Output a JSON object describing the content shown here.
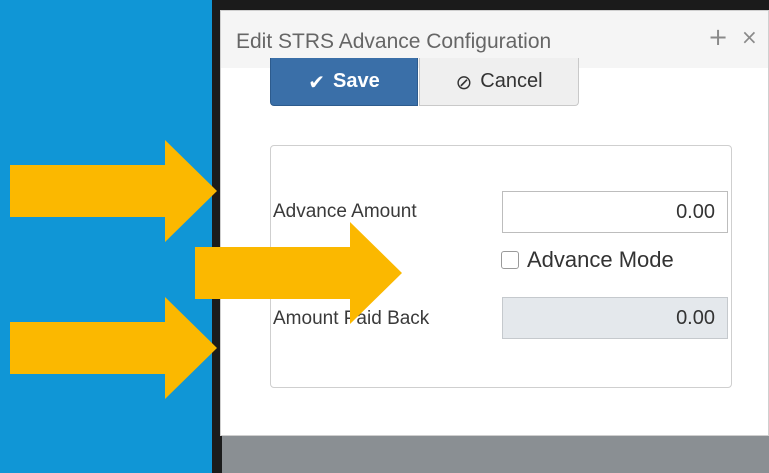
{
  "dialog": {
    "title": "Edit STRS Advance Configuration",
    "pin_glyph": "+",
    "close_glyph": "×"
  },
  "toolbar": {
    "save_label": "Save",
    "save_icon": "✔",
    "cancel_label": "Cancel",
    "cancel_icon": "⊘"
  },
  "form": {
    "advance_amount_label": "Advance Amount",
    "advance_amount_value": "0.00",
    "advance_mode_label": "Advance Mode",
    "advance_mode_checked": false,
    "amount_paid_back_label": "Amount Paid Back",
    "amount_paid_back_value": "0.00"
  },
  "colors": {
    "background": "#1096d6",
    "arrow": "#fbb800",
    "save_button": "#3a6fa8"
  },
  "annotations": {
    "arrow_count": 3
  }
}
